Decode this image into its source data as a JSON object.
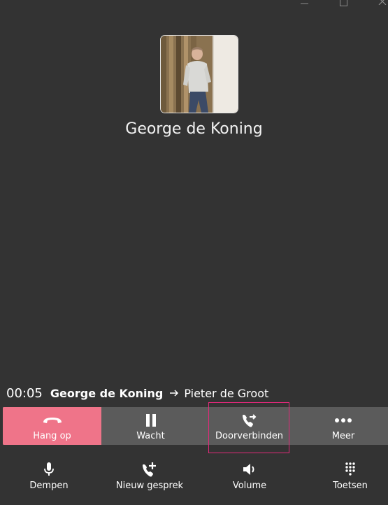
{
  "window_controls": {
    "minimize_icon": "minimize-icon",
    "maximize_icon": "maximize-icon",
    "close_icon": "close-icon"
  },
  "contact": {
    "name": "George de Koning",
    "avatar": "contact-photo"
  },
  "call_status": {
    "timer": "00:05",
    "caller": "George de Koning",
    "arrow_icon": "arrow-right-icon",
    "target": "Pieter de Groot"
  },
  "actions": {
    "hangup": {
      "label": "Hang op",
      "icon": "phone-hangup-icon",
      "color": "#ef7489"
    },
    "wait": {
      "label": "Wacht",
      "icon": "pause-icon"
    },
    "transfer": {
      "label": "Doorverbinden",
      "icon": "phone-forward-icon"
    },
    "more": {
      "label": "Meer",
      "icon": "more-horizontal-icon"
    },
    "bar_color": "#5b5b5b",
    "highlight_color": "#e2297a"
  },
  "bottom": {
    "mute": {
      "label": "Dempen",
      "icon": "microphone-icon"
    },
    "new_call": {
      "label": "Nieuw gesprek",
      "icon": "phone-add-icon"
    },
    "volume": {
      "label": "Volume",
      "icon": "speaker-icon"
    },
    "keypad": {
      "label": "Toetsen",
      "icon": "dialpad-icon"
    }
  },
  "background_color": "#333333"
}
